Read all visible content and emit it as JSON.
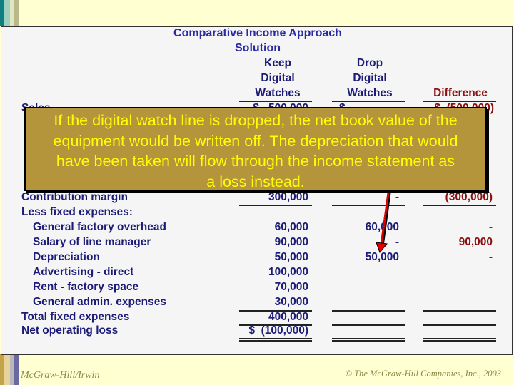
{
  "title": "Comparative Income Approach",
  "subtitle": "Solution",
  "columns": {
    "keep": [
      "Keep",
      "Digital",
      "Watches"
    ],
    "drop": [
      "Drop",
      "Digital",
      "Watches"
    ],
    "difference": "Difference"
  },
  "sales": {
    "label": "Sales",
    "keep": "$   500,000",
    "drop": "$          -",
    "difference": "$  (500,000)"
  },
  "rows": [
    {
      "label": "Contribution margin",
      "keep": "300,000",
      "drop": "-",
      "difference": "(300,000)",
      "indent": false
    },
    {
      "label": "Less fixed expenses:",
      "keep": "",
      "drop": "",
      "difference": "",
      "indent": false
    },
    {
      "label": "General factory overhead",
      "keep": "60,000",
      "drop": "60,000",
      "difference": "-",
      "indent": true
    },
    {
      "label": "Salary of line manager",
      "keep": "90,000",
      "drop": "-",
      "difference": "90,000",
      "indent": true
    },
    {
      "label": "Depreciation",
      "keep": "50,000",
      "drop": "50,000",
      "difference": "-",
      "indent": true
    },
    {
      "label": "Advertising - direct",
      "keep": "100,000",
      "drop": "",
      "difference": "",
      "indent": true
    },
    {
      "label": "Rent - factory space",
      "keep": "70,000",
      "drop": "",
      "difference": "",
      "indent": true
    },
    {
      "label": "General admin. expenses",
      "keep": "30,000",
      "drop": "",
      "difference": "",
      "indent": true
    },
    {
      "label": "Total fixed expenses",
      "keep": "400,000",
      "drop": "",
      "difference": "",
      "indent": false
    },
    {
      "label": "Net operating loss",
      "keep": "$  (100,000)",
      "drop": "",
      "difference": "",
      "indent": false
    }
  ],
  "callout": {
    "lines": [
      "If the digital watch line is dropped, the net book value of the",
      "equipment would be written off. The depreciation that would",
      "have been taken will flow through the income statement as",
      "a loss instead."
    ]
  },
  "footer": {
    "left": "McGraw-Hill/Irwin",
    "right": "© The McGraw-Hill Companies, Inc., 2003"
  },
  "colors": {
    "text": "#1c1c78",
    "difference": "#8b0f0f",
    "callout_bg": "#b4953c",
    "callout_text": "#ffff00",
    "arrow": "#e00000"
  }
}
